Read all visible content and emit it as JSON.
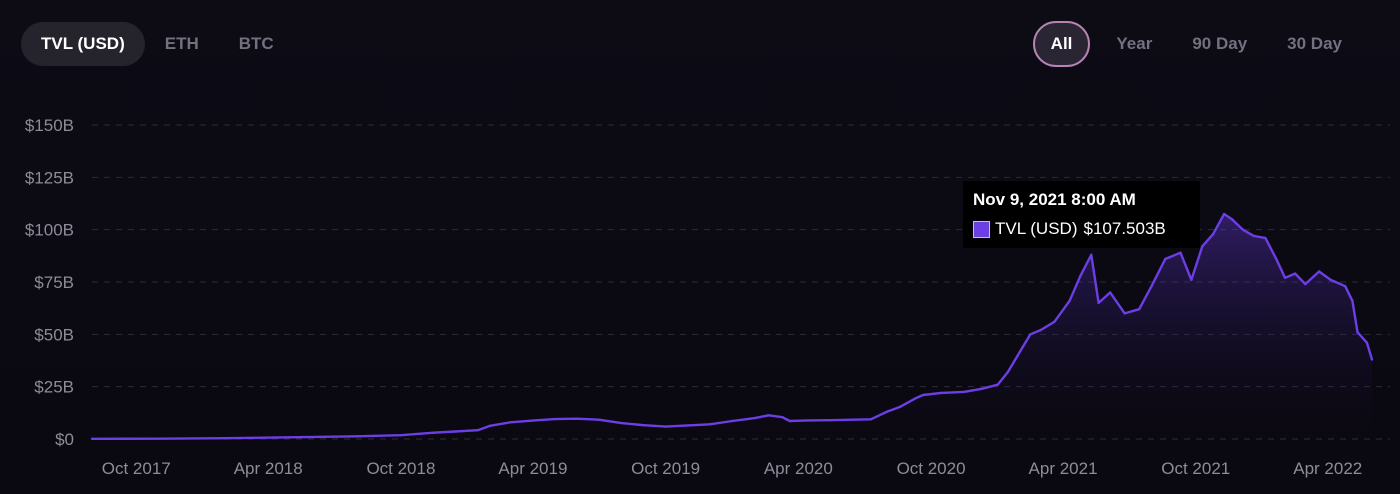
{
  "tabs": [
    {
      "label": "TVL (USD)",
      "active": true
    },
    {
      "label": "ETH",
      "active": false
    },
    {
      "label": "BTC",
      "active": false
    }
  ],
  "ranges": [
    {
      "label": "All",
      "active": true
    },
    {
      "label": "Year",
      "active": false
    },
    {
      "label": "90 Day",
      "active": false
    },
    {
      "label": "30 Day",
      "active": false
    }
  ],
  "tooltip": {
    "date": "Nov 9, 2021 8:00 AM",
    "series_label": "TVL (USD)",
    "value_label": "$107.503B"
  },
  "colors": {
    "line": "#6c3ee6",
    "grid": "#2f2b38",
    "axis_text": "#8f8b99",
    "active_range_border": "#b783b3"
  },
  "chart_data": {
    "type": "area",
    "title": "",
    "xlabel": "",
    "ylabel": "",
    "ylim": [
      0,
      150
    ],
    "y_unit": "billion USD",
    "y_ticks": [
      0,
      25,
      50,
      75,
      100,
      125,
      150
    ],
    "y_tick_labels": [
      "$0",
      "$25B",
      "$50B",
      "$75B",
      "$100B",
      "$125B",
      "$150B"
    ],
    "xlim": [
      "2017-08-01",
      "2022-06-01"
    ],
    "x_ticks": [
      "2017-10-01",
      "2018-04-01",
      "2018-10-01",
      "2019-04-01",
      "2019-10-01",
      "2020-04-01",
      "2020-10-01",
      "2021-04-01",
      "2021-10-01",
      "2022-04-01"
    ],
    "x_tick_labels": [
      "Oct 2017",
      "Apr 2018",
      "Oct 2018",
      "Apr 2019",
      "Oct 2019",
      "Apr 2020",
      "Oct 2020",
      "Apr 2021",
      "Oct 2021",
      "Apr 2022"
    ],
    "grid": true,
    "series": [
      {
        "name": "TVL (USD)",
        "points": [
          [
            "2017-08-01",
            0.1
          ],
          [
            "2017-11-01",
            0.15
          ],
          [
            "2018-02-01",
            0.4
          ],
          [
            "2018-05-01",
            0.8
          ],
          [
            "2018-08-01",
            1.3
          ],
          [
            "2018-10-01",
            1.8
          ],
          [
            "2018-11-15",
            3.0
          ],
          [
            "2018-12-15",
            3.6
          ],
          [
            "2019-01-15",
            4.2
          ],
          [
            "2019-02-01",
            6.3
          ],
          [
            "2019-03-01",
            8.0
          ],
          [
            "2019-04-01",
            8.8
          ],
          [
            "2019-05-01",
            9.5
          ],
          [
            "2019-06-01",
            9.7
          ],
          [
            "2019-07-01",
            9.2
          ],
          [
            "2019-08-01",
            7.6
          ],
          [
            "2019-09-01",
            6.6
          ],
          [
            "2019-10-01",
            5.9
          ],
          [
            "2019-11-01",
            6.5
          ],
          [
            "2019-12-01",
            7.0
          ],
          [
            "2020-01-01",
            8.6
          ],
          [
            "2020-02-01",
            10.0
          ],
          [
            "2020-02-20",
            11.3
          ],
          [
            "2020-03-10",
            10.4
          ],
          [
            "2020-03-20",
            8.6
          ],
          [
            "2020-04-15",
            8.9
          ],
          [
            "2020-05-15",
            9.0
          ],
          [
            "2020-06-15",
            9.2
          ],
          [
            "2020-07-10",
            9.4
          ],
          [
            "2020-08-01",
            13.0
          ],
          [
            "2020-08-20",
            15.5
          ],
          [
            "2020-09-10",
            19.5
          ],
          [
            "2020-09-20",
            21.0
          ],
          [
            "2020-10-15",
            22.0
          ],
          [
            "2020-11-15",
            22.5
          ],
          [
            "2020-12-10",
            24.0
          ],
          [
            "2021-01-01",
            26.0
          ],
          [
            "2021-01-15",
            32.0
          ],
          [
            "2021-02-01",
            42.0
          ],
          [
            "2021-02-15",
            50.0
          ],
          [
            "2021-03-01",
            52.0
          ],
          [
            "2021-03-20",
            56.0
          ],
          [
            "2021-04-10",
            66.0
          ],
          [
            "2021-04-25",
            78.0
          ],
          [
            "2021-05-10",
            88.0
          ],
          [
            "2021-05-20",
            65.0
          ],
          [
            "2021-06-05",
            70.0
          ],
          [
            "2021-06-25",
            60.0
          ],
          [
            "2021-07-15",
            62.0
          ],
          [
            "2021-08-01",
            73.0
          ],
          [
            "2021-08-20",
            86.0
          ],
          [
            "2021-09-10",
            89.0
          ],
          [
            "2021-09-25",
            76.0
          ],
          [
            "2021-10-10",
            92.0
          ],
          [
            "2021-10-25",
            98.0
          ],
          [
            "2021-11-09",
            107.5
          ],
          [
            "2021-11-20",
            105.0
          ],
          [
            "2021-12-05",
            100.0
          ],
          [
            "2021-12-20",
            97.0
          ],
          [
            "2022-01-05",
            96.0
          ],
          [
            "2022-01-20",
            86.0
          ],
          [
            "2022-02-01",
            77.0
          ],
          [
            "2022-02-15",
            79.0
          ],
          [
            "2022-03-01",
            74.0
          ],
          [
            "2022-03-20",
            80.0
          ],
          [
            "2022-04-05",
            76.0
          ],
          [
            "2022-04-25",
            73.0
          ],
          [
            "2022-05-05",
            66.0
          ],
          [
            "2022-05-12",
            51.0
          ],
          [
            "2022-05-25",
            46.0
          ],
          [
            "2022-06-01",
            38.0
          ]
        ]
      }
    ]
  }
}
